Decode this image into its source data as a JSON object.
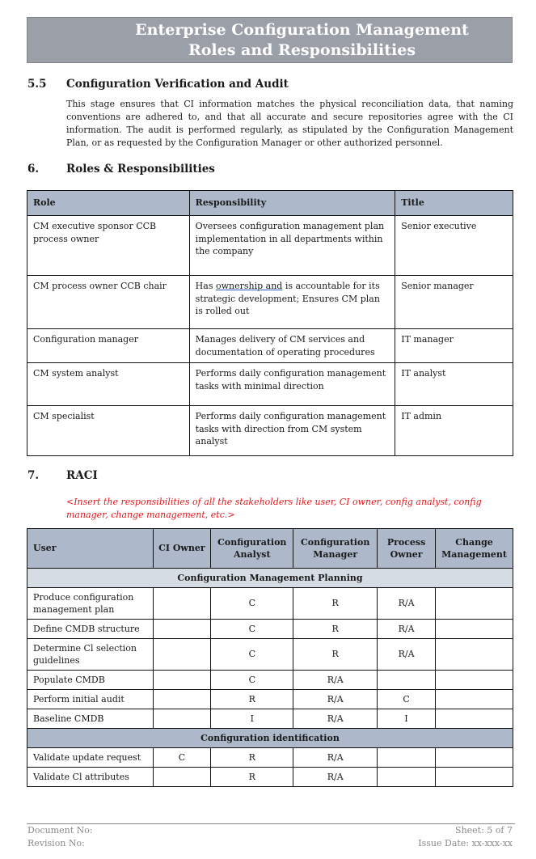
{
  "banner": {
    "line1": "Enterprise Configuration Management",
    "line2": "Roles and Responsibilities"
  },
  "section_5_5": {
    "number": "5.5",
    "title": "Configuration Verification and Audit",
    "body": "This stage ensures that CI information matches the physical reconciliation data, that naming conventions are adhered to, and that all accurate and secure repositories agree with the CI information. The audit is performed regularly, as stipulated by the Configuration Management Plan, or as requested by the Configuration Manager or other authorized personnel."
  },
  "section_6": {
    "number": "6.",
    "title": "Roles & Responsibilities",
    "headers": [
      "Role",
      "Responsibility",
      "Title"
    ],
    "rows": [
      {
        "role": "CM executive sponsor CCB process owner",
        "responsibility": "Oversees configuration management plan implementation in all departments within the company",
        "title": "Senior executive"
      },
      {
        "role": "CM process owner CCB chair",
        "responsibility_pre": "Has ",
        "responsibility_underlined": "ownership and",
        "responsibility_post": " is accountable for its strategic development; Ensures CM plan is rolled out",
        "title": "Senior manager"
      },
      {
        "role": "Configuration manager",
        "responsibility": "Manages delivery of CM services and documentation of operating procedures",
        "title": "IT manager"
      },
      {
        "role": "CM system analyst",
        "responsibility": "Performs daily configuration management tasks with minimal direction",
        "title": "IT analyst"
      },
      {
        "role": "CM specialist",
        "responsibility": "Performs daily configuration management tasks with direction from CM system analyst",
        "title": "IT admin"
      }
    ]
  },
  "section_7": {
    "number": "7.",
    "title": "RACI",
    "note": "<Insert the responsibilities of all the stakeholders like user, CI owner, config analyst, config manager, change management, etc.>",
    "headers": [
      "User",
      "CI Owner",
      "Configuration Analyst",
      "Configuration Manager",
      "Process Owner",
      "Change Management"
    ],
    "groups": [
      {
        "name": "Configuration Management Planning",
        "rows": [
          [
            "Produce configuration management plan",
            "",
            "C",
            "R",
            "R/A",
            ""
          ],
          [
            "Define CMDB structure",
            "",
            "C",
            "R",
            "R/A",
            ""
          ],
          [
            "Determine Cl selection guidelines",
            "",
            "C",
            "R",
            "R/A",
            ""
          ],
          [
            "Populate CMDB",
            "",
            "C",
            "R/A",
            "",
            ""
          ],
          [
            "Perform initial audit",
            "",
            "R",
            "R/A",
            "C",
            ""
          ],
          [
            "Baseline CMDB",
            "",
            "I",
            "R/A",
            "I",
            ""
          ]
        ]
      },
      {
        "name": "Configuration identification",
        "rows": [
          [
            "Validate update request",
            "C",
            "R",
            "R/A",
            "",
            ""
          ],
          [
            "Validate Cl attributes",
            "",
            "R",
            "R/A",
            "",
            ""
          ]
        ]
      }
    ]
  },
  "footer": {
    "document_no": "Document No:",
    "revision_no": "Revision No:",
    "sheet": "Sheet: 5 of 7",
    "issue_date": "Issue Date: xx-xxx-xx"
  }
}
